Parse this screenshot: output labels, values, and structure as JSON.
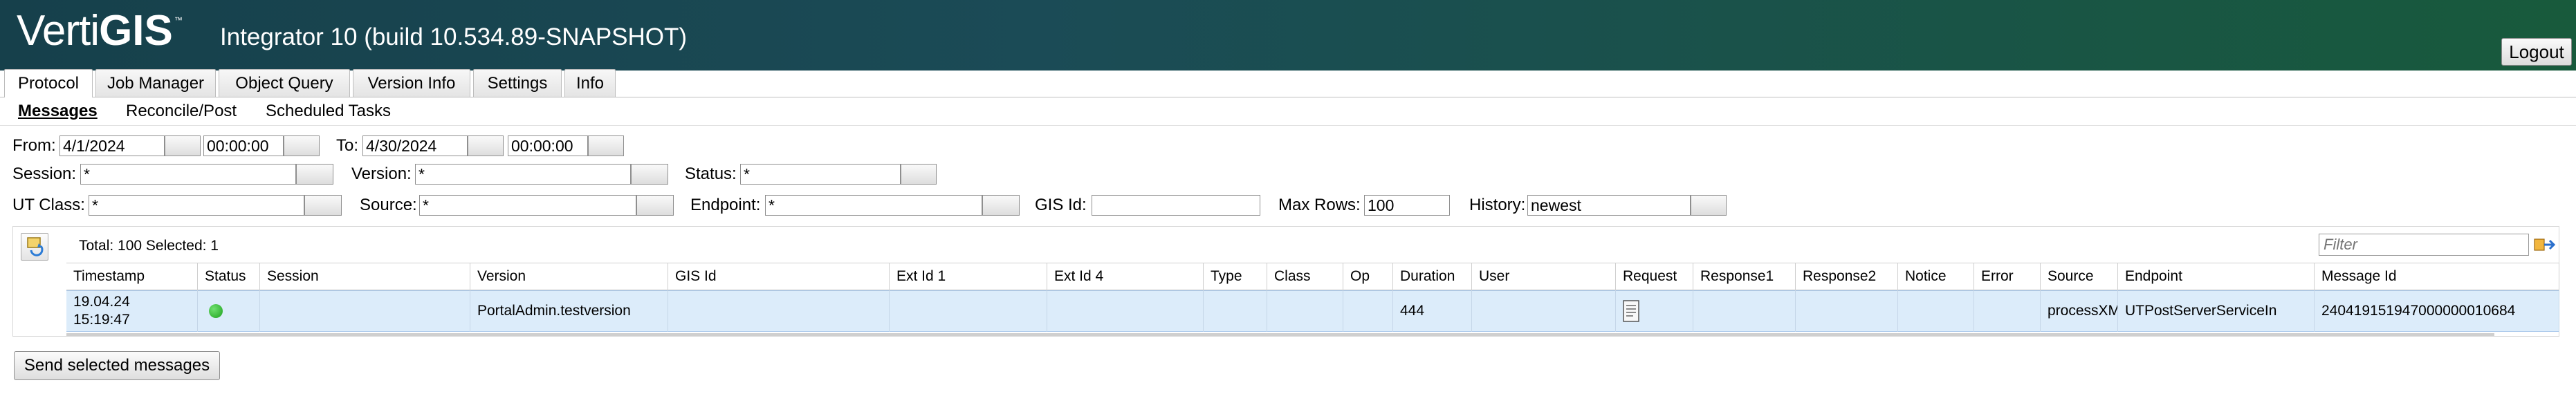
{
  "header": {
    "logo_part1": "Verti",
    "logo_part2": "GIS",
    "logo_tm": "™",
    "app_title": "Integrator 10 (build 10.534.89-SNAPSHOT)",
    "logout_label": "Logout"
  },
  "main_tabs": [
    "Protocol",
    "Job Manager",
    "Object Query",
    "Version Info",
    "Settings",
    "Info"
  ],
  "active_main_tab": "Protocol",
  "sub_tabs": [
    "Messages",
    "Reconcile/Post",
    "Scheduled Tasks"
  ],
  "active_sub_tab": "Messages",
  "filters": {
    "from_label": "From:",
    "from_date": "4/1/2024",
    "from_time": "00:00:00",
    "to_label": "To:",
    "to_date": "4/30/2024",
    "to_time": "00:00:00",
    "session_label": "Session:",
    "session_value": "*",
    "version_label": "Version:",
    "version_value": "*",
    "status_label": "Status:",
    "status_value": "*",
    "utclass_label": "UT Class:",
    "utclass_value": "*",
    "source_label": "Source:",
    "source_value": "*",
    "endpoint_label": "Endpoint:",
    "endpoint_value": "*",
    "gisid_label": "GIS Id:",
    "gisid_value": "",
    "maxrows_label": "Max Rows:",
    "maxrows_value": "100",
    "history_label": "History:",
    "history_value": "newest"
  },
  "grid": {
    "total_text": "Total: 100 Selected: 1",
    "filter_placeholder": "Filter",
    "columns": [
      "Timestamp",
      "Status",
      "Session",
      "Version",
      "GIS Id",
      "Ext Id 1",
      "Ext Id 4",
      "Type",
      "Class",
      "Op",
      "Duration",
      "User",
      "Request",
      "Response1",
      "Response2",
      "Notice",
      "Error",
      "Source",
      "Endpoint",
      "Message Id"
    ],
    "rows": [
      {
        "timestamp_date": "19.04.24",
        "timestamp_time": "15:19:47",
        "status": "ok",
        "session": "",
        "version": "PortalAdmin.testversion",
        "gis_id": "",
        "ext_id_1": "",
        "ext_id_4": "",
        "type": "",
        "class": "",
        "op": "",
        "duration": "444",
        "user": "",
        "request": "document-icon",
        "response1": "",
        "response2": "",
        "notice": "",
        "error": "",
        "source": "processXM",
        "endpoint": "UTPostServerServiceIn",
        "message_id": "240419151947000000010684"
      }
    ]
  },
  "actions": {
    "send_selected_label": "Send selected messages"
  },
  "colors": {
    "header_start": "#16404b",
    "header_end": "#185a3c",
    "row_selected": "#dcecfa",
    "status_ok": "#1fa21f"
  }
}
